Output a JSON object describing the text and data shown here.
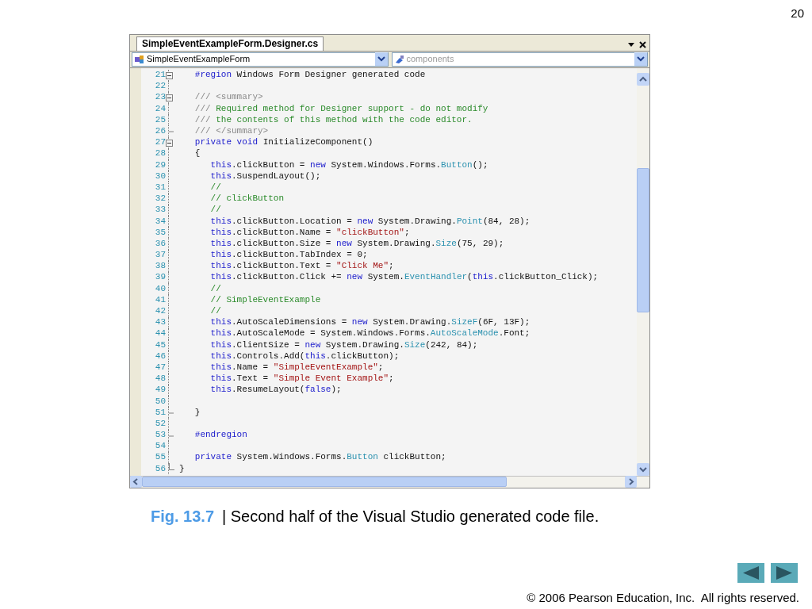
{
  "slide_number": "20",
  "editor": {
    "tab": {
      "label": "SimpleEventExampleForm.Designer.cs",
      "selected": true
    },
    "class_dropdown": "SimpleEventExampleForm",
    "member_dropdown": {
      "placeholder": "components"
    },
    "lines": [
      {
        "number": "21",
        "kind": "open",
        "tokens": [
          {
            "kind": "kw",
            "text": "   #region"
          },
          {
            "kind": "plain",
            "text": " Windows Form Designer generated code"
          }
        ]
      },
      {
        "number": "22"
      },
      {
        "number": "23",
        "kind": "open",
        "tokens": [
          {
            "kind": "doc",
            "text": "   /// <summary>"
          }
        ]
      },
      {
        "number": "24",
        "tokens": [
          {
            "kind": "doc",
            "text": "   ///"
          },
          {
            "kind": "comment",
            "text": " Required method for Designer support - do not modify"
          }
        ]
      },
      {
        "number": "25",
        "tokens": [
          {
            "kind": "doc",
            "text": "   ///"
          },
          {
            "kind": "comment",
            "text": " the contents of this method with the code editor."
          }
        ]
      },
      {
        "number": "26",
        "kind": "end",
        "tokens": [
          {
            "kind": "doc",
            "text": "   /// </summary>"
          }
        ]
      },
      {
        "number": "27",
        "kind": "open",
        "tokens": [
          {
            "kind": "kw",
            "text": "   private void"
          },
          {
            "kind": "plain",
            "text": " InitializeComponent()"
          }
        ]
      },
      {
        "number": "28",
        "tokens": [
          {
            "kind": "plain",
            "text": "   {"
          }
        ]
      },
      {
        "number": "29",
        "tokens": [
          {
            "kind": "kw",
            "text": "      this"
          },
          {
            "kind": "plain",
            "text": ".clickButton = "
          },
          {
            "kind": "kw",
            "text": "new"
          },
          {
            "kind": "plain",
            "text": " System.Windows.Forms."
          },
          {
            "kind": "type",
            "text": "Button"
          },
          {
            "kind": "plain",
            "text": "();"
          }
        ]
      },
      {
        "number": "30",
        "tokens": [
          {
            "kind": "kw",
            "text": "      this"
          },
          {
            "kind": "plain",
            "text": ".SuspendLayout();"
          }
        ]
      },
      {
        "number": "31",
        "tokens": [
          {
            "kind": "comment",
            "text": "      //"
          }
        ]
      },
      {
        "number": "32",
        "tokens": [
          {
            "kind": "comment",
            "text": "      // clickButton"
          }
        ]
      },
      {
        "number": "33",
        "tokens": [
          {
            "kind": "comment",
            "text": "      //"
          }
        ]
      },
      {
        "number": "34",
        "tokens": [
          {
            "kind": "kw",
            "text": "      this"
          },
          {
            "kind": "plain",
            "text": ".clickButton.Location = "
          },
          {
            "kind": "kw",
            "text": "new"
          },
          {
            "kind": "plain",
            "text": " System.Drawing."
          },
          {
            "kind": "type",
            "text": "Point"
          },
          {
            "kind": "plain",
            "text": "(84, 28);"
          }
        ]
      },
      {
        "number": "35",
        "tokens": [
          {
            "kind": "kw",
            "text": "      this"
          },
          {
            "kind": "plain",
            "text": ".clickButton.Name = "
          },
          {
            "kind": "str",
            "text": "\"clickButton\""
          },
          {
            "kind": "plain",
            "text": ";"
          }
        ]
      },
      {
        "number": "36",
        "tokens": [
          {
            "kind": "kw",
            "text": "      this"
          },
          {
            "kind": "plain",
            "text": ".clickButton.Size = "
          },
          {
            "kind": "kw",
            "text": "new"
          },
          {
            "kind": "plain",
            "text": " System.Drawing."
          },
          {
            "kind": "type",
            "text": "Size"
          },
          {
            "kind": "plain",
            "text": "(75, 29);"
          }
        ]
      },
      {
        "number": "37",
        "tokens": [
          {
            "kind": "kw",
            "text": "      this"
          },
          {
            "kind": "plain",
            "text": ".clickButton.TabIndex = 0;"
          }
        ]
      },
      {
        "number": "38",
        "tokens": [
          {
            "kind": "kw",
            "text": "      this"
          },
          {
            "kind": "plain",
            "text": ".clickButton.Text = "
          },
          {
            "kind": "str",
            "text": "\"Click Me\""
          },
          {
            "kind": "plain",
            "text": ";"
          }
        ]
      },
      {
        "number": "39",
        "tokens": [
          {
            "kind": "kw",
            "text": "      this"
          },
          {
            "kind": "plain",
            "text": ".clickButton.Click += "
          },
          {
            "kind": "kw",
            "text": "new"
          },
          {
            "kind": "plain",
            "text": " System."
          },
          {
            "kind": "type",
            "text": "EventHandler"
          },
          {
            "kind": "plain",
            "text": "("
          },
          {
            "kind": "kw",
            "text": "this"
          },
          {
            "kind": "plain",
            "text": ".clickButton_Click);"
          }
        ]
      },
      {
        "number": "40",
        "tokens": [
          {
            "kind": "comment",
            "text": "      //"
          }
        ]
      },
      {
        "number": "41",
        "tokens": [
          {
            "kind": "comment",
            "text": "      // SimpleEventExample"
          }
        ]
      },
      {
        "number": "42",
        "tokens": [
          {
            "kind": "comment",
            "text": "      //"
          }
        ]
      },
      {
        "number": "43",
        "tokens": [
          {
            "kind": "kw",
            "text": "      this"
          },
          {
            "kind": "plain",
            "text": ".AutoScaleDimensions = "
          },
          {
            "kind": "kw",
            "text": "new"
          },
          {
            "kind": "plain",
            "text": " System.Drawing."
          },
          {
            "kind": "type",
            "text": "SizeF"
          },
          {
            "kind": "plain",
            "text": "(6F, 13F);"
          }
        ]
      },
      {
        "number": "44",
        "tokens": [
          {
            "kind": "kw",
            "text": "      this"
          },
          {
            "kind": "plain",
            "text": ".AutoScaleMode = System.Windows.Forms."
          },
          {
            "kind": "type",
            "text": "AutoScaleMode"
          },
          {
            "kind": "plain",
            "text": ".Font;"
          }
        ]
      },
      {
        "number": "45",
        "tokens": [
          {
            "kind": "kw",
            "text": "      this"
          },
          {
            "kind": "plain",
            "text": ".ClientSize = "
          },
          {
            "kind": "kw",
            "text": "new"
          },
          {
            "kind": "plain",
            "text": " System.Drawing."
          },
          {
            "kind": "type",
            "text": "Size"
          },
          {
            "kind": "plain",
            "text": "(242, 84);"
          }
        ]
      },
      {
        "number": "46",
        "tokens": [
          {
            "kind": "kw",
            "text": "      this"
          },
          {
            "kind": "plain",
            "text": ".Controls.Add("
          },
          {
            "kind": "kw",
            "text": "this"
          },
          {
            "kind": "plain",
            "text": ".clickButton);"
          }
        ]
      },
      {
        "number": "47",
        "tokens": [
          {
            "kind": "kw",
            "text": "      this"
          },
          {
            "kind": "plain",
            "text": ".Name = "
          },
          {
            "kind": "str",
            "text": "\"SimpleEventExample\""
          },
          {
            "kind": "plain",
            "text": ";"
          }
        ]
      },
      {
        "number": "48",
        "tokens": [
          {
            "kind": "kw",
            "text": "      this"
          },
          {
            "kind": "plain",
            "text": ".Text = "
          },
          {
            "kind": "str",
            "text": "\"Simple Event Example\""
          },
          {
            "kind": "plain",
            "text": ";"
          }
        ]
      },
      {
        "number": "49",
        "tokens": [
          {
            "kind": "kw",
            "text": "      this"
          },
          {
            "kind": "plain",
            "text": ".ResumeLayout("
          },
          {
            "kind": "kw",
            "text": "false"
          },
          {
            "kind": "plain",
            "text": ");"
          }
        ]
      },
      {
        "number": "50"
      },
      {
        "number": "51",
        "kind": "end",
        "tokens": [
          {
            "kind": "plain",
            "text": "   }"
          }
        ]
      },
      {
        "number": "52"
      },
      {
        "number": "53",
        "kind": "end",
        "tokens": [
          {
            "kind": "kw",
            "text": "   #endregion"
          }
        ]
      },
      {
        "number": "54"
      },
      {
        "number": "55",
        "tokens": [
          {
            "kind": "kw",
            "text": "   private"
          },
          {
            "kind": "plain",
            "text": " System.Windows.Forms."
          },
          {
            "kind": "type",
            "text": "Button"
          },
          {
            "kind": "plain",
            "text": " clickButton;"
          }
        ]
      },
      {
        "number": "56",
        "kind": "last",
        "tokens": [
          {
            "kind": "plain",
            "text": "}"
          }
        ]
      }
    ]
  },
  "caption": {
    "label": "Fig. 13.7",
    "text": "| Second half of the Visual Studio generated code file."
  },
  "copyright": "© 2006 Pearson Education, Inc.  All rights reserved."
}
